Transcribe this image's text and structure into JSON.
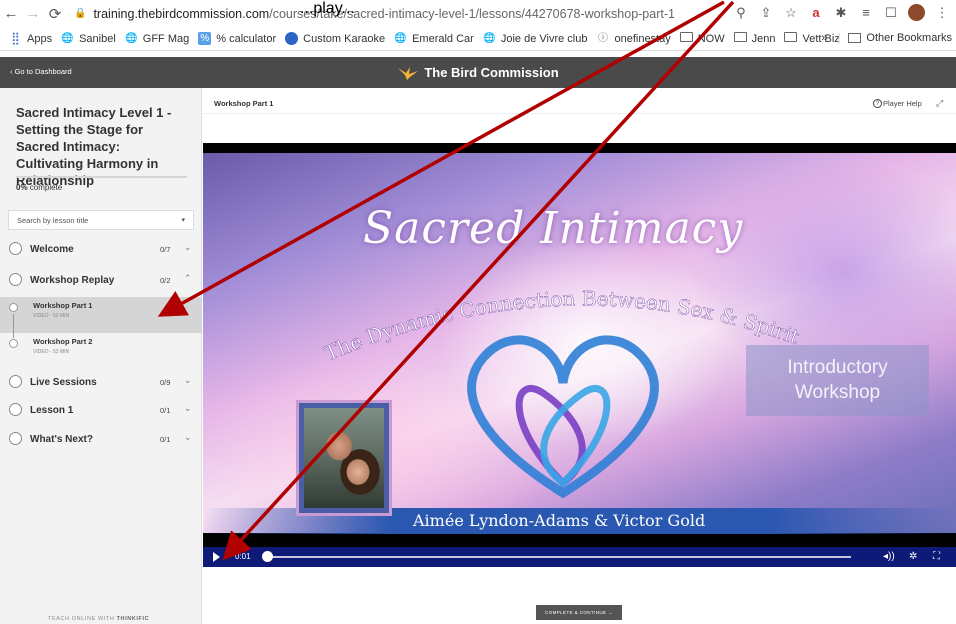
{
  "browser": {
    "url_prefix": "training.thebirdcommission.com",
    "url_path": "/courses/take/sacred-intimacy-level-1/lessons/44270678-workshop-part-1",
    "bookmarks": [
      {
        "label": "Apps",
        "icon": "apps-grid-icon"
      },
      {
        "label": "Sanibel",
        "icon": "globe-icon"
      },
      {
        "label": "GFF Mag",
        "icon": "globe-icon"
      },
      {
        "label": "% calculator",
        "icon": "calculator-icon"
      },
      {
        "label": "Custom Karaoke",
        "icon": "karaoke-icon"
      },
      {
        "label": "Emerald Car",
        "icon": "globe-icon"
      },
      {
        "label": "Joie de Vivre club",
        "icon": "globe-icon"
      },
      {
        "label": "onefinestay",
        "icon": "site-icon"
      },
      {
        "label": "NOW",
        "icon": "folder-icon"
      },
      {
        "label": "Jenn",
        "icon": "folder-icon"
      },
      {
        "label": "Vett Biz",
        "icon": "folder-icon"
      }
    ],
    "more_bookmarks": "»",
    "other_bookmarks": "Other Bookmarks"
  },
  "top_caption": "...play...",
  "header": {
    "back_label": "‹  Go to Dashboard",
    "brand": "The Bird Commission",
    "brand_color": "#f2b233"
  },
  "sidebar": {
    "course_title": "Sacred Intimacy Level 1 - Setting the Stage for Sacred Intimacy: Cultivating Harmony in Relationship",
    "progress_percent": "0%",
    "progress_label": "complete",
    "search_placeholder": "Search by lesson title",
    "chapters": [
      {
        "title": "Welcome",
        "count": "0/7",
        "chevron": "⌄"
      },
      {
        "title": "Workshop Replay",
        "count": "0/2",
        "chevron": "⌃"
      },
      {
        "title": "Live Sessions",
        "count": "0/9",
        "chevron": "⌄"
      },
      {
        "title": "Lesson 1",
        "count": "0/1",
        "chevron": "⌄"
      },
      {
        "title": "What's Next?",
        "count": "0/1",
        "chevron": "⌄"
      }
    ],
    "lessons": [
      {
        "title": "Workshop Part 1",
        "meta": "VIDEO · 50 MIN",
        "active": true
      },
      {
        "title": "Workshop Part 2",
        "meta": "VIDEO · 53 MIN",
        "active": false
      }
    ],
    "footer_prefix": "TEACH ONLINE WITH",
    "footer_brand": "THINKIFIC"
  },
  "main": {
    "lesson_title": "Workshop Part 1",
    "player_help": "Player Help",
    "complete_button": "COMPLETE & CONTINUE  →"
  },
  "video": {
    "title": "Sacred Intimacy",
    "subtitle": "The Dynamic Connection Between Sex & Spirit",
    "intro_line1": "Introductory",
    "intro_line2": "Workshop",
    "presenters": "Aimée Lyndon-Adams & Victor Gold",
    "current_time": "0:01",
    "progress": 0.0,
    "controls_color": "#0e1a78"
  },
  "annotation": {
    "arrow_color": "#b00000"
  }
}
